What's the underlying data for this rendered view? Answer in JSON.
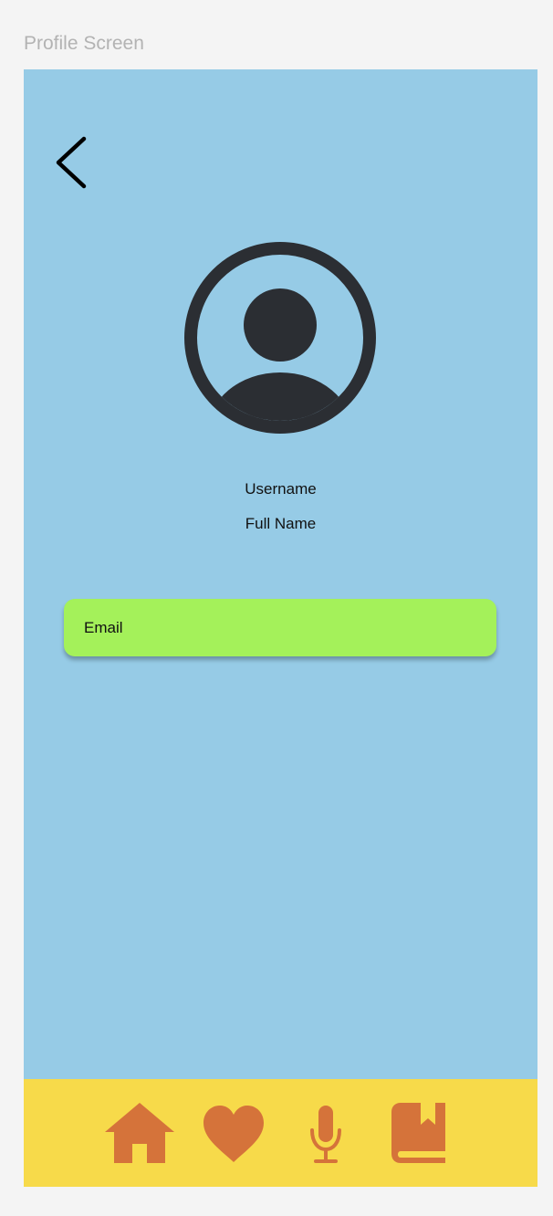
{
  "frame": {
    "label": "Profile Screen"
  },
  "profile": {
    "username": "Username",
    "full_name": "Full Name",
    "email_placeholder": "Email"
  },
  "icons": {
    "back": "chevron-left-icon",
    "avatar": "user-circle-icon",
    "nav": [
      "home-icon",
      "heart-icon",
      "microphone-icon",
      "bookmark-book-icon"
    ]
  },
  "colors": {
    "page_background": "#f4f4f4",
    "screen_background": "#96cbe6",
    "email_field": "#a4f15a",
    "bottom_nav": "#f7da4a",
    "nav_icon": "#d5733a",
    "avatar": "#2b2e33"
  }
}
